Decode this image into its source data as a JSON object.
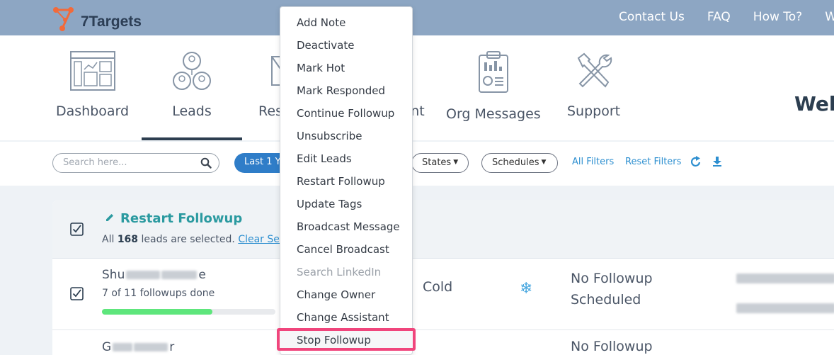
{
  "brand": {
    "logo_text": "7Targets"
  },
  "top_nav": {
    "links": [
      "Contact Us",
      "FAQ",
      "How To?",
      "W"
    ]
  },
  "main_nav": {
    "items": [
      {
        "label": "Dashboard",
        "icon": "dashboard-icon"
      },
      {
        "label": "Leads",
        "icon": "leads-icon"
      },
      {
        "label": "Res",
        "icon": "responses-icon"
      },
      {
        "label": "nt",
        "icon": "assistant-icon"
      },
      {
        "label": "Org Messages",
        "icon": "org-messages-icon"
      },
      {
        "label": "Support",
        "icon": "support-icon"
      }
    ],
    "active": "Leads",
    "welcome_text": "Wel"
  },
  "filters": {
    "search_placeholder": "Search here...",
    "date_range_label": "Last 1 Y",
    "states_label": "States",
    "schedules_label": "Schedules",
    "all_filters": "All Filters",
    "reset_filters": "Reset Filters",
    "refresh_icon": "refresh-icon",
    "download_icon": "download-icon"
  },
  "selection": {
    "title": "Restart Followup",
    "text_prefix": "All",
    "count": "168",
    "text_suffix": "leads are selected.",
    "clear_label": "Clear Sel"
  },
  "rows": [
    {
      "name_prefix": "Shu",
      "name_suffix": "e",
      "followups_text": "7 of 11 followups done",
      "progress": 0.636,
      "state": "Cold",
      "state_icon": "snowflake-icon",
      "schedule_line1": "No Followup",
      "schedule_line2": "Scheduled"
    },
    {
      "name_prefix": "G",
      "name_suffix": "r",
      "schedule_line1": "No Followup"
    }
  ],
  "context_menu": {
    "items": [
      {
        "label": "Add Note",
        "disabled": false
      },
      {
        "label": "Deactivate",
        "disabled": false
      },
      {
        "label": "Mark Hot",
        "disabled": false
      },
      {
        "label": "Mark Responded",
        "disabled": false
      },
      {
        "label": "Continue Followup",
        "disabled": false
      },
      {
        "label": "Unsubscribe",
        "disabled": false
      },
      {
        "label": "Edit Leads",
        "disabled": false
      },
      {
        "label": "Restart Followup",
        "disabled": false
      },
      {
        "label": "Update Tags",
        "disabled": false
      },
      {
        "label": "Broadcast Message",
        "disabled": false
      },
      {
        "label": "Cancel Broadcast",
        "disabled": false
      },
      {
        "label": "Search LinkedIn",
        "disabled": true
      },
      {
        "label": "Change Owner",
        "disabled": false
      },
      {
        "label": "Change Assistant",
        "disabled": false
      },
      {
        "label": "Stop Followup",
        "disabled": false,
        "highlighted": true
      }
    ]
  },
  "colors": {
    "topbar": "#8da6c3",
    "accent_teal": "#2b9aa0",
    "link_blue": "#2d8fd0",
    "highlight_pink": "#f0457c",
    "progress_green": "#5ee67c"
  }
}
